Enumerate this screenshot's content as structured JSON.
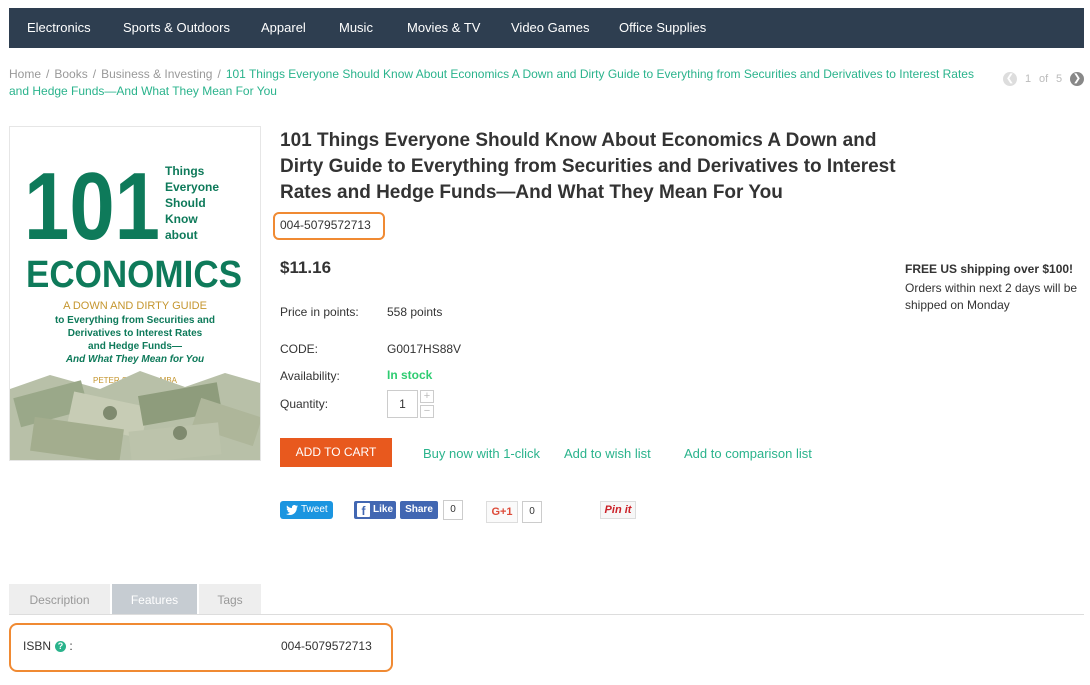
{
  "nav": {
    "items": [
      "Electronics",
      "Sports & Outdoors",
      "Apparel",
      "Music",
      "Movies & TV",
      "Video Games",
      "Office Supplies"
    ]
  },
  "breadcrumb": {
    "home": "Home",
    "books": "Books",
    "category": "Business & Investing",
    "separator": "/",
    "current": "101 Things Everyone Should Know About Economics A Down and Dirty Guide to Everything from Securities and Derivatives to Interest Rates and Hedge Funds—And What They Mean For You"
  },
  "pager": {
    "current": "1",
    "of": "of",
    "total": "5"
  },
  "cover": {
    "big_number": "101",
    "things_lines": [
      "Things",
      "Everyone",
      "Should",
      "Know",
      "about"
    ],
    "subject": "ECONOMICS",
    "subtitle1": "A DOWN AND DIRTY GUIDE",
    "subtitle2": "to Everything from Securities and",
    "subtitle3": "Derivatives to Interest Rates",
    "subtitle4": "and Hedge Funds—",
    "subtitle5": "And What They Mean for You",
    "author": "PETER SANDER, MBA"
  },
  "product": {
    "title": "101 Things Everyone Should Know About Economics A Down and Dirty Guide to Everything from Securities and Derivatives to Interest Rates and Hedge Funds—And What They Mean For You",
    "sku": "004-5079572713",
    "price": "$11.16",
    "points_label": "Price in points:",
    "points_value": "558 points",
    "code_label": "CODE:",
    "code_value": "G0017HS88V",
    "availability_label": "Availability:",
    "availability_value": "In stock",
    "quantity_label": "Quantity:",
    "quantity_value": "1",
    "plus": "+",
    "minus": "−"
  },
  "shipping": {
    "title": "FREE US shipping over $100!",
    "text": "Orders within next 2 days will be shipped on Monday"
  },
  "actions": {
    "add_to_cart": "ADD TO CART",
    "buy_now": "Buy now with 1-click",
    "wish_list": "Add to wish list",
    "comparison": "Add to comparison list"
  },
  "social": {
    "tweet": "Tweet",
    "like": "Like",
    "share": "Share",
    "fb_count": "0",
    "gplus": "G+1",
    "gplus_count": "0",
    "pin": "Pin it"
  },
  "tabs": [
    "Description",
    "Features",
    "Tags"
  ],
  "features": {
    "isbn_label": "ISBN",
    "help": "?",
    "colon": ":",
    "isbn_value": "004-5079572713"
  },
  "colors": {
    "nav_bg": "#2e3e50",
    "accent": "#2ab38c",
    "cart": "#e8591e",
    "highlight": "#f08a33",
    "cover_green": "#0e7a5a"
  }
}
